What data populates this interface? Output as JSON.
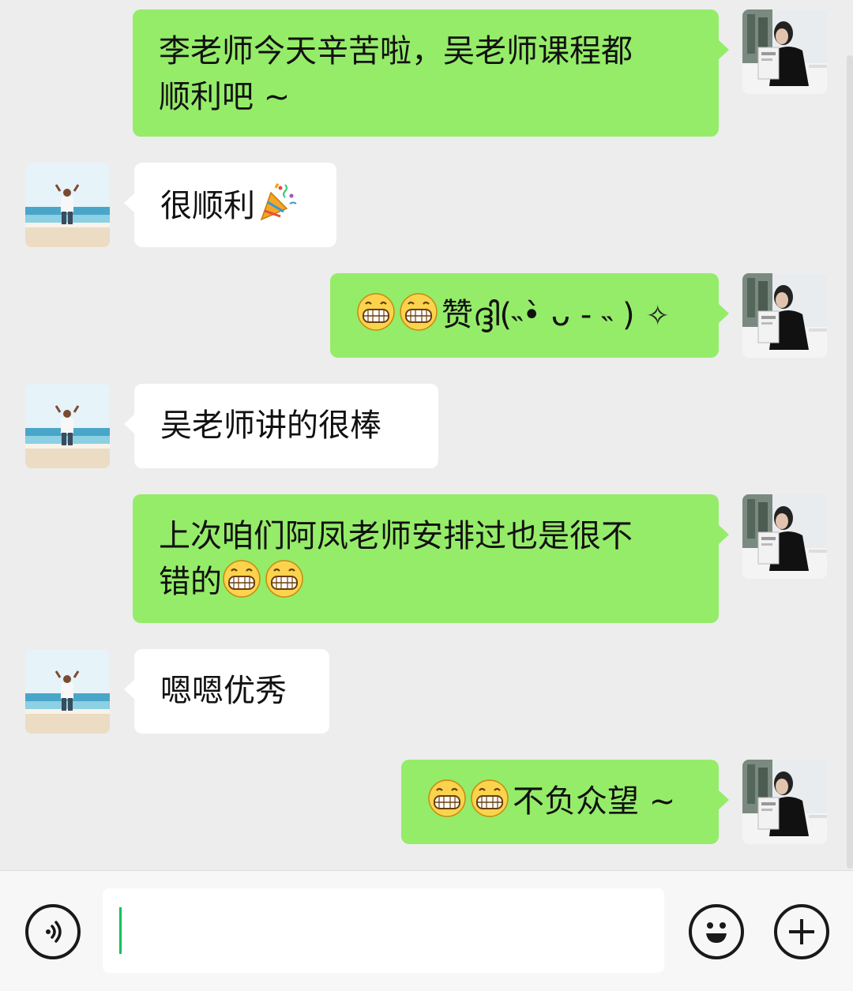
{
  "colors": {
    "me_bubble": "#95ec69",
    "peer_bubble": "#ffffff",
    "background": "#ededed",
    "caret": "#07c160"
  },
  "messages": [
    {
      "sender": "me",
      "text_line1": "李老师今天辛苦啦，吴老师课程都",
      "text_line2": "顺利吧 ~"
    },
    {
      "sender": "peer",
      "text": "很顺利",
      "emoji": "party-popper"
    },
    {
      "sender": "me",
      "emoji": "grin, grin",
      "text": "赞ദ്ദി(˵•̀ ᴗ - ˵ )",
      "trailing": "✧"
    },
    {
      "sender": "peer",
      "text": "吴老师讲的很棒"
    },
    {
      "sender": "me",
      "text_line1": "上次咱们阿凤老师安排过也是很不",
      "text_line2": "错的",
      "emoji": "grin, grin"
    },
    {
      "sender": "peer",
      "text": "嗯嗯优秀"
    },
    {
      "sender": "me",
      "emoji": "grin, grin",
      "text": "不负众望 ~"
    }
  ],
  "input_bar": {
    "voice_icon": "voice-icon",
    "text_value": "",
    "emoji_icon": "emoji-icon",
    "plus_icon": "plus-icon"
  }
}
